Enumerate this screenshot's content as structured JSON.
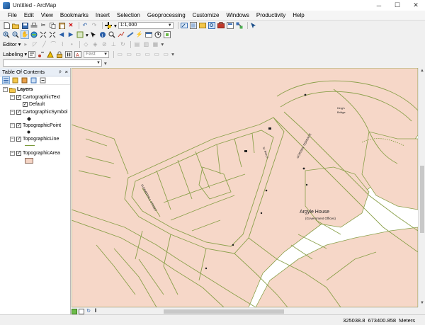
{
  "window": {
    "title": "Untitled - ArcMap",
    "minimize": "─",
    "maximize": "☐",
    "close": "✕"
  },
  "menu": [
    "File",
    "Edit",
    "View",
    "Bookmarks",
    "Insert",
    "Selection",
    "Geoprocessing",
    "Customize",
    "Windows",
    "Productivity",
    "Help"
  ],
  "toolbar": {
    "scale": "1:1,000",
    "editor_label": "Editor",
    "labeling_label": "Labeling",
    "label_quality": "Fast",
    "text_input": ""
  },
  "toc": {
    "title": "Table Of Contents",
    "pin": "ᵖ",
    "close": "×",
    "root": "Layers",
    "layers": [
      {
        "name": "CartographicText",
        "checked": true,
        "sub": "Default"
      },
      {
        "name": "CartographicSymbol",
        "checked": true
      },
      {
        "name": "TopographicPoint",
        "checked": true
      },
      {
        "name": "TopographicLine",
        "checked": true
      },
      {
        "name": "TopographicArea",
        "checked": true
      }
    ],
    "colors": {
      "area_fill": "#f5d5c6",
      "line": "#7a9a3a"
    }
  },
  "map": {
    "area_fill": "#f6d7c8",
    "line_color": "#8aa04a",
    "labels": {
      "argyle": "Argyle House",
      "govoffices": "(Government Offices)",
      "king": "King's",
      "bridge": "Bridge",
      "gorden": "GORDEN TERRACE",
      "summerhill": "SUMMERHILL STREET",
      "steps": "St. Mary's"
    }
  },
  "status": {
    "x": "325038.8",
    "y": "673400.858",
    "units": "Meters"
  }
}
